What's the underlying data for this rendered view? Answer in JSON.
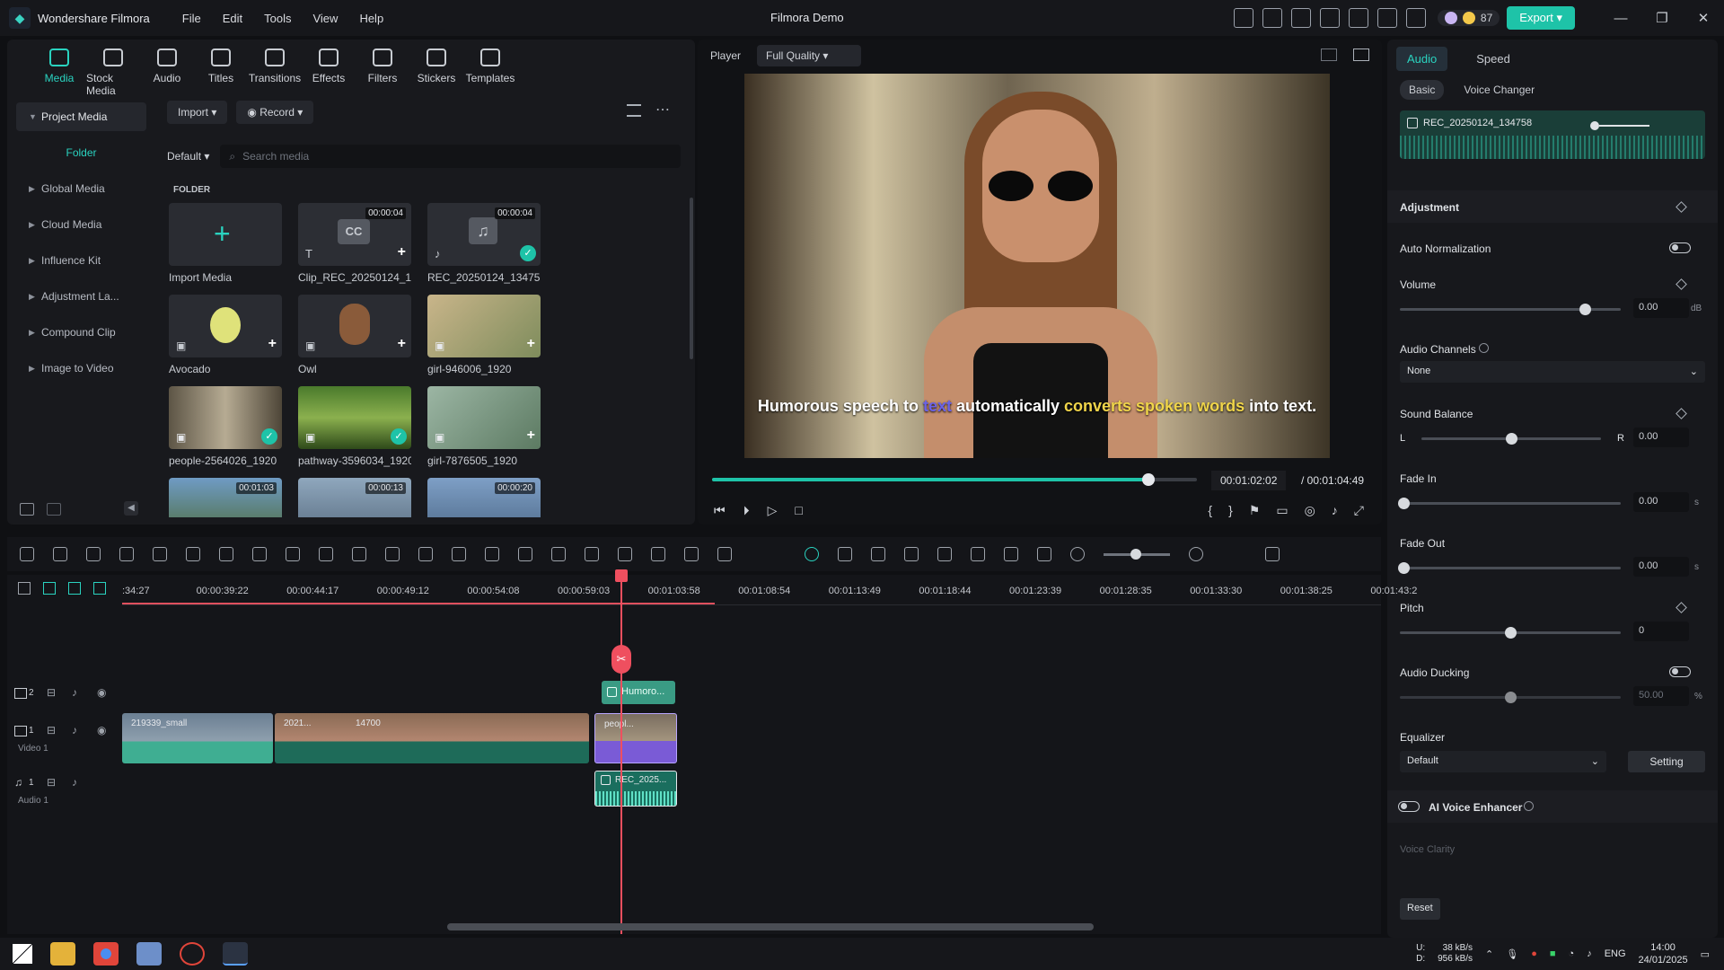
{
  "app": {
    "name": "Wondershare Filmora",
    "window_title": "Filmora Demo",
    "menus": [
      "File",
      "Edit",
      "Tools",
      "View",
      "Help"
    ],
    "credits": "87",
    "export_label": "Export"
  },
  "tabs": [
    "Media",
    "Stock Media",
    "Audio",
    "Titles",
    "Transitions",
    "Effects",
    "Filters",
    "Stickers",
    "Templates"
  ],
  "leftnav": {
    "project_media": "Project Media",
    "folder": "Folder",
    "items": [
      "Global Media",
      "Cloud Media",
      "Influence Kit",
      "Adjustment La...",
      "Compound Clip",
      "Image to Video"
    ]
  },
  "toolbar": {
    "import": "Import",
    "record": "Record",
    "sort": "Default",
    "search_placeholder": "Search media"
  },
  "folder_label": "FOLDER",
  "media": [
    {
      "name": "Import Media",
      "duration": ""
    },
    {
      "name": "Clip_REC_20250124_13...",
      "duration": "00:00:04"
    },
    {
      "name": "REC_20250124_134758",
      "duration": "00:00:04"
    },
    {
      "name": "Avocado",
      "duration": ""
    },
    {
      "name": "Owl",
      "duration": ""
    },
    {
      "name": "girl-946006_1920",
      "duration": ""
    },
    {
      "name": "people-2564026_1920",
      "duration": ""
    },
    {
      "name": "pathway-3596034_1920",
      "duration": ""
    },
    {
      "name": "girl-7876505_1920",
      "duration": ""
    },
    {
      "name": "",
      "duration": "00:01:03"
    },
    {
      "name": "",
      "duration": "00:00:13"
    },
    {
      "name": "",
      "duration": "00:00:20"
    }
  ],
  "player": {
    "label": "Player",
    "quality": "Full Quality",
    "subtitle_parts": [
      "Humorous speech to ",
      "text",
      " automatically ",
      "converts spoken words",
      " into text."
    ],
    "current_time": "00:01:02:02",
    "total_time": "/ 00:01:04:49",
    "progress": 0.9
  },
  "rpanel": {
    "tabs": [
      "Audio",
      "Speed"
    ],
    "subtabs": [
      "Basic",
      "Voice Changer"
    ],
    "clip_name": "REC_20250124_134758",
    "adjustment": "Adjustment",
    "auto_normalization": "Auto Normalization",
    "volume": {
      "label": "Volume",
      "value": "0.00",
      "unit": "dB"
    },
    "channels": {
      "label": "Audio Channels",
      "value": "None"
    },
    "balance": {
      "label": "Sound Balance",
      "l": "L",
      "r": "R",
      "value": "0.00"
    },
    "fade_in": {
      "label": "Fade In",
      "value": "0.00",
      "unit": "s"
    },
    "fade_out": {
      "label": "Fade Out",
      "value": "0.00",
      "unit": "s"
    },
    "pitch": {
      "label": "Pitch",
      "value": "0"
    },
    "ducking": {
      "label": "Audio Ducking",
      "value": "50.00",
      "unit": "%"
    },
    "equalizer": {
      "label": "Equalizer",
      "value": "Default",
      "setting": "Setting"
    },
    "ai_voice": "AI Voice Enhancer",
    "voice_clarity": "Voice Clarity",
    "reset": "Reset"
  },
  "timeline": {
    "ticks": [
      ":34:27",
      "00:00:39:22",
      "00:00:44:17",
      "00:00:49:12",
      "00:00:54:08",
      "00:00:59:03",
      "00:01:03:58",
      "00:01:08:54",
      "00:01:13:49",
      "00:01:18:44",
      "00:01:23:39",
      "00:01:28:35",
      "00:01:33:30",
      "00:01:38:25",
      "00:01:43:2"
    ],
    "tracks": {
      "t2": "2",
      "video1": "Video 1",
      "audio1": "Audio 1",
      "v1num": "1",
      "a1num": "1"
    },
    "clips": {
      "title": "Humoro...",
      "video_a": "219339_small",
      "video_b": "2021...",
      "video_c": "14700",
      "video_d": "peopl...",
      "audio": "REC_2025..."
    }
  },
  "taskbar": {
    "net_up": "38 kB/s",
    "net_down": "956 kB/s",
    "lang": "ENG",
    "time": "14:00",
    "date": "24/01/2025",
    "u": "U:",
    "d": "D:"
  }
}
